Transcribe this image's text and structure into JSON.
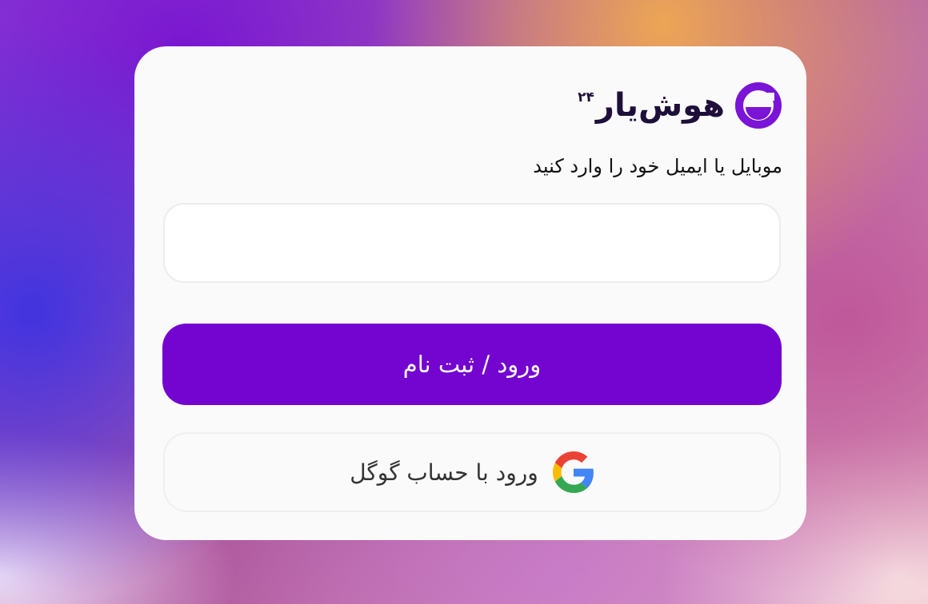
{
  "brand": {
    "name": "هوش‌یار",
    "superscript": "۲۴",
    "icon": "hooshyar-logo-icon",
    "color": "#7a14d6"
  },
  "form": {
    "prompt": "موبایل یا ایمیل خود را وارد کنید",
    "input_value": "",
    "input_placeholder": ""
  },
  "buttons": {
    "submit_label": "ورود / ثبت نام",
    "submit_color": "#7404d0",
    "google_label": "ورود با حساب گوگل",
    "google_icon": "google-icon"
  }
}
